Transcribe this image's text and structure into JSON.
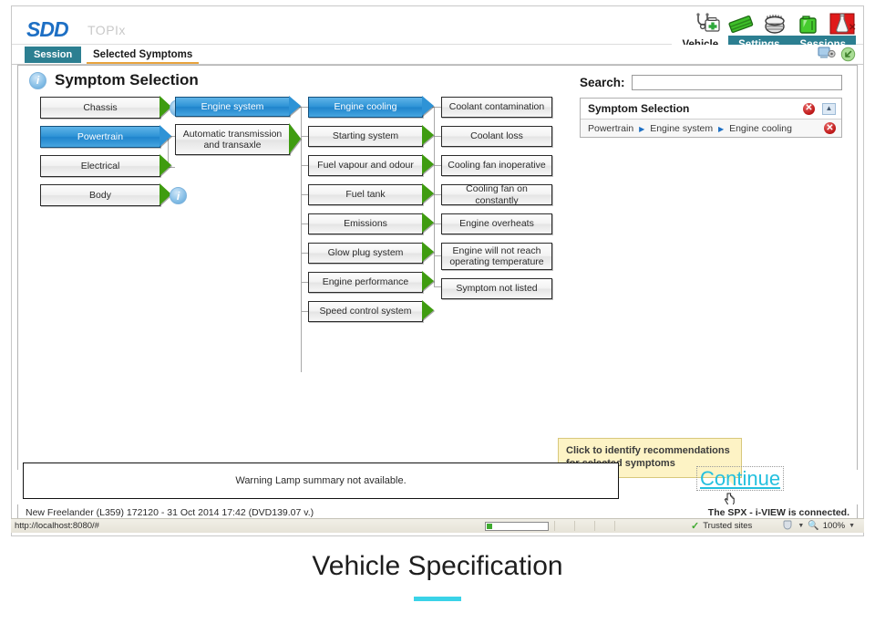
{
  "brand": {
    "logo": "SDD",
    "sub_logo": "TOPIx"
  },
  "header_icons": [
    {
      "name": "diagnostics-icon",
      "title": "Diagnostics"
    },
    {
      "name": "battery-icon",
      "title": "Battery"
    },
    {
      "name": "tyre-icon",
      "title": "Tyre"
    },
    {
      "name": "fuel-can-icon",
      "title": "Fuel"
    },
    {
      "name": "fluid-bottle-icon",
      "title": "Fluids"
    }
  ],
  "nav_tabs": [
    {
      "label": "Vehicle",
      "active": true
    },
    {
      "label": "Settings",
      "active": false
    },
    {
      "label": "Sessions",
      "active": false
    }
  ],
  "session_bar": {
    "session_tab": "Session",
    "symptoms_tab": "Selected Symptoms",
    "icons": [
      {
        "name": "screen-share-icon"
      },
      {
        "name": "refresh-icon"
      }
    ]
  },
  "page": {
    "title": "Symptom Selection",
    "info_icon": "i"
  },
  "tree": {
    "col1": [
      {
        "label": "Chassis",
        "selected": false,
        "arrow": true,
        "info": true
      },
      {
        "label": "Powertrain",
        "selected": true,
        "arrow": true,
        "info": false
      },
      {
        "label": "Electrical",
        "selected": false,
        "arrow": true,
        "info": false
      },
      {
        "label": "Body",
        "selected": false,
        "arrow": true,
        "info": true
      }
    ],
    "col2": [
      {
        "label": "Engine system",
        "selected": true,
        "arrow": true,
        "tall": false
      },
      {
        "label": "Automatic transmission and transaxle",
        "selected": false,
        "arrow": true,
        "tall": true
      }
    ],
    "col3": [
      {
        "label": "Engine cooling",
        "selected": true,
        "arrow": true
      },
      {
        "label": "Starting system",
        "selected": false,
        "arrow": true
      },
      {
        "label": "Fuel vapour and odour",
        "selected": false,
        "arrow": true
      },
      {
        "label": "Fuel tank",
        "selected": false,
        "arrow": true
      },
      {
        "label": "Emissions",
        "selected": false,
        "arrow": true
      },
      {
        "label": "Glow plug system",
        "selected": false,
        "arrow": true
      },
      {
        "label": "Engine performance",
        "selected": false,
        "arrow": true
      },
      {
        "label": "Speed control system",
        "selected": false,
        "arrow": true
      }
    ],
    "col4": [
      {
        "label": "Coolant contamination",
        "tall": false
      },
      {
        "label": "Coolant loss",
        "tall": false
      },
      {
        "label": "Cooling fan inoperative",
        "tall": false
      },
      {
        "label": "Cooling fan on constantly",
        "tall": false
      },
      {
        "label": "Engine overheats",
        "tall": false
      },
      {
        "label": "Engine will not reach operating temperature",
        "tall": true
      },
      {
        "label": "Symptom not listed",
        "tall": false
      }
    ]
  },
  "search": {
    "label": "Search:",
    "value": "",
    "placeholder": ""
  },
  "selection_panel": {
    "title": "Symptom Selection",
    "close_glyph": "✕",
    "collapse_glyph": "▲",
    "breadcrumb": [
      "Powertrain",
      "Engine system",
      "Engine cooling"
    ],
    "separator": "▶",
    "row_close_glyph": "✕"
  },
  "tooltip": {
    "line1": "Click to identify recommendations",
    "line2": "for selected symptoms"
  },
  "bottom": {
    "warning_text": "Warning Lamp summary not available.",
    "continue_label": "Continue",
    "vehicle_info": "New Freelander (L359) 172120 - 31 Oct 2014 17:42 (DVD139.07 v.)",
    "spx_status": "The SPX - i-VIEW is connected."
  },
  "status_bar": {
    "url": "http://localhost:8080/#",
    "zone_label": "Trusted sites",
    "zone_check": "✓",
    "zoom_level": "100%",
    "caret": "▼"
  },
  "caption": {
    "title": "Vehicle Specification",
    "rule_color": "#3ad3e8"
  }
}
